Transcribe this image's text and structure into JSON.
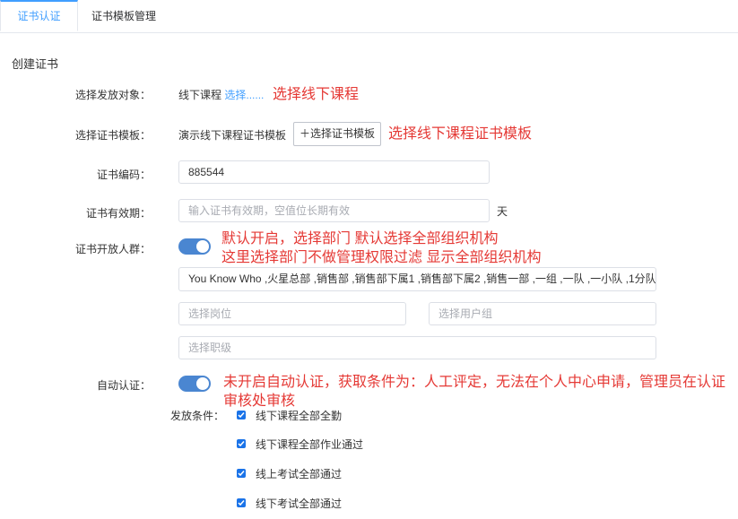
{
  "tabs": [
    "证书认证",
    "证书模板管理"
  ],
  "section_title": "创建证书",
  "fields": {
    "issue_target": {
      "label": "选择发放对象：",
      "value": "线下课程",
      "link": "选择......",
      "annotation": "选择线下课程"
    },
    "template": {
      "label": "选择证书模板：",
      "value": "演示线下课程证书模板",
      "button": "＋选择证书模板",
      "annotation": "选择线下课程证书模板"
    },
    "code": {
      "label": "证书编码：",
      "value": "885544"
    },
    "validity": {
      "label": "证书有效期：",
      "placeholder": "输入证书有效期，空值位长期有效",
      "unit": "天"
    },
    "audience": {
      "label": "证书开放人群：",
      "annotation_line1": "默认开启，选择部门 默认选择全部组织机构",
      "annotation_line2": "这里选择部门不做管理权限过滤 显示全部组织机构",
      "departments": "You Know Who ,火星总部 ,销售部 ,销售部下属1 ,销售部下属2 ,销售一部 ,一组 ,一队 ,一小队 ,1分队",
      "position_placeholder": "选择岗位",
      "usergroup_placeholder": "选择用户组",
      "level_placeholder": "选择职级"
    },
    "auto_cert": {
      "label": "自动认证：",
      "annotation_line1": "未开启自动认证，获取条件为：人工评定，无法在个人中心申请，管理员在认证",
      "annotation_line2": "审核处审核"
    },
    "conditions": {
      "label": "发放条件：",
      "items": [
        "线下课程全部全勤",
        "线下课程全部作业通过",
        "线上考试全部通过",
        "线下考试全部通过"
      ]
    }
  },
  "colors": {
    "accent": "#409eff",
    "annotation": "#e53935",
    "toggle": "#4a86d1",
    "checkbox": "#1a73e8"
  }
}
